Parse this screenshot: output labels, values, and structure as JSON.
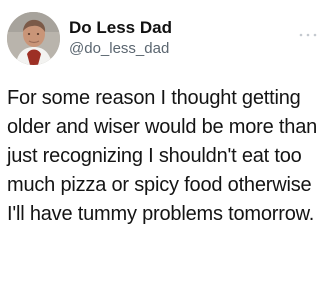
{
  "tweet": {
    "author": {
      "display_name": "Do Less Dad",
      "handle": "@do_less_dad"
    },
    "text": "For some reason I thought getting older and wiser would be more than just recognizing I shouldn't eat too much pizza or spicy food otherwise I'll have tummy problems tomorrow."
  },
  "icons": {
    "more": "more-horizontal-icon",
    "avatar": "profile-photo"
  },
  "colors": {
    "background": "#ffffff",
    "text": "#141414",
    "handle": "#5b6670",
    "more_icon": "#c4c9cf"
  }
}
